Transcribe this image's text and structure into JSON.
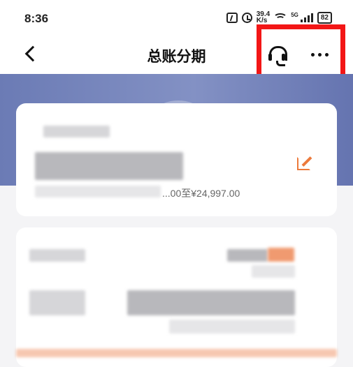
{
  "status_bar": {
    "time": "8:36",
    "net_speed_value": "39.4",
    "net_speed_unit": "K/s",
    "signal_label": "5G",
    "battery": "82"
  },
  "nav": {
    "title": "总账分期"
  },
  "card1": {
    "range_text": "...00至¥24,997.00"
  },
  "colors": {
    "accent": "#ec7a3c",
    "highlight": "#f31616",
    "banner": "#7080b9"
  }
}
